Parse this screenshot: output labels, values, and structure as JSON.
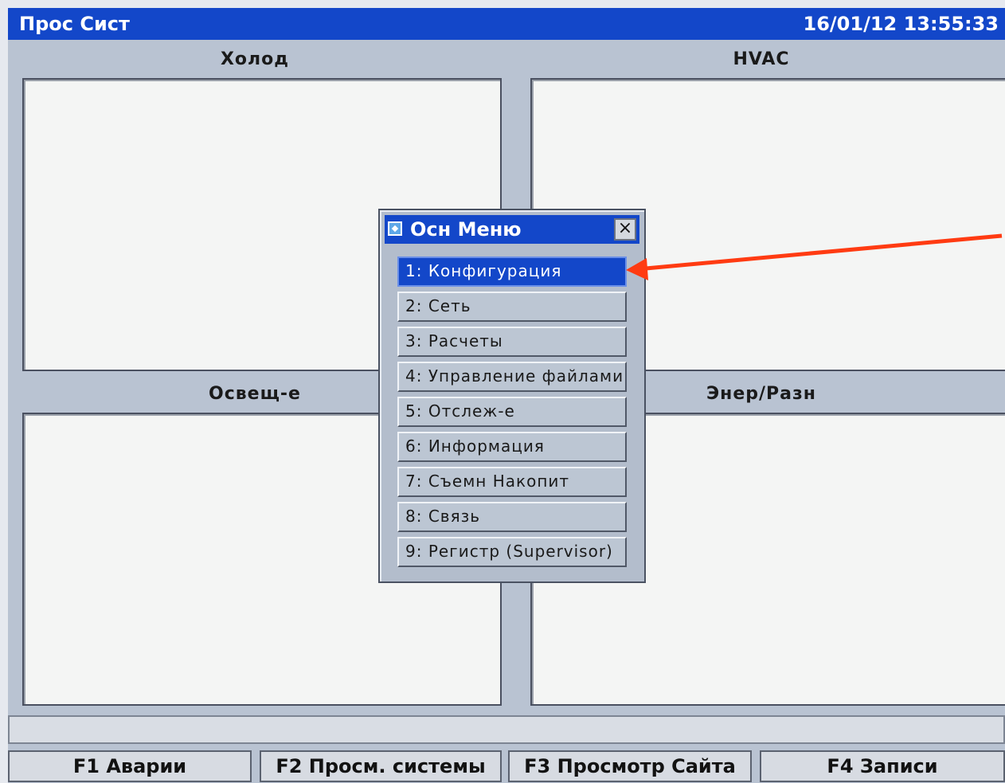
{
  "titlebar": {
    "title": "Прос Сист",
    "datetime": "16/01/12 13:55:33"
  },
  "quadrants": {
    "top_left": "Холод",
    "top_right": "HVAC",
    "bottom_left": "Освещ-е",
    "bottom_right": "Энер/Разн"
  },
  "dialog": {
    "title": "Осн Меню",
    "close_glyph": "×",
    "items": [
      {
        "label": "1: Конфигурация",
        "selected": true
      },
      {
        "label": "2: Сеть"
      },
      {
        "label": "3: Расчеты"
      },
      {
        "label": "4: Управление файлами"
      },
      {
        "label": "5: Отслеж-е"
      },
      {
        "label": "6: Информация"
      },
      {
        "label": "7: Съемн Накопит"
      },
      {
        "label": "8: Связь"
      },
      {
        "label": "9: Регистр (Supervisor)"
      }
    ]
  },
  "function_keys": [
    "F1 Аварии",
    "F2 Просм. системы",
    "F3 Просмотр Сайта",
    "F4 Записи"
  ],
  "colors": {
    "titlebar": "#1347c9",
    "annotation_arrow": "#ff3b12"
  }
}
